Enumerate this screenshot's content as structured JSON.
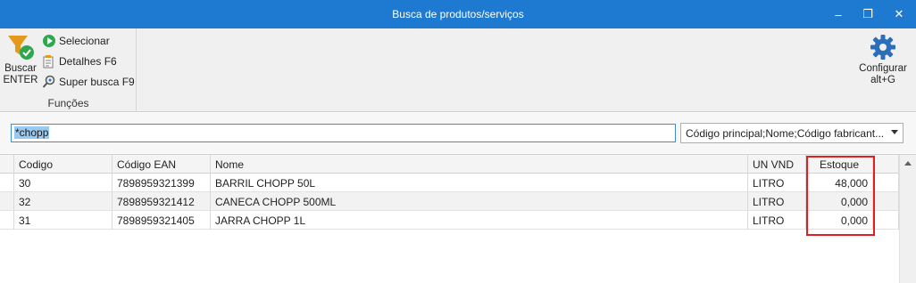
{
  "window": {
    "title": "Busca de produtos/serviços",
    "controls": {
      "minimize": "–",
      "restore": "❐",
      "close": "✕"
    }
  },
  "ribbon": {
    "buscar": {
      "label_line1": "Buscar",
      "label_line2": "ENTER",
      "icon": "filter-check-icon"
    },
    "selecionar": {
      "label": "Selecionar",
      "icon": "select-icon"
    },
    "detalhes": {
      "label": "Detalhes F6",
      "icon": "details-icon"
    },
    "super_busca": {
      "label": "Super busca F9",
      "icon": "search-icon"
    },
    "group_label": "Funções",
    "configurar": {
      "label_line1": "Configurar",
      "label_line2": "alt+G",
      "icon": "gear-icon"
    }
  },
  "search": {
    "value": "*chopp",
    "fields_selected": "Código principal;Nome;Código fabricant..."
  },
  "table": {
    "columns": {
      "codigo": "Codigo",
      "ean": "Código EAN",
      "nome": "Nome",
      "un": "UN VND",
      "estoque": "Estoque"
    },
    "rows": [
      {
        "codigo": "30",
        "ean": "7898959321399",
        "nome": "BARRIL CHOPP 50L",
        "un": "LITRO",
        "estoque": "48,000"
      },
      {
        "codigo": "32",
        "ean": "7898959321412",
        "nome": "CANECA CHOPP 500ML",
        "un": "LITRO",
        "estoque": "0,000"
      },
      {
        "codigo": "31",
        "ean": "7898959321405",
        "nome": "JARRA CHOPP 1L",
        "un": "LITRO",
        "estoque": "0,000"
      }
    ]
  },
  "colors": {
    "titlebar": "#1e7ad1",
    "highlight": "#e02020",
    "input_border": "#3c8ad8",
    "selection": "#99c9ef"
  }
}
